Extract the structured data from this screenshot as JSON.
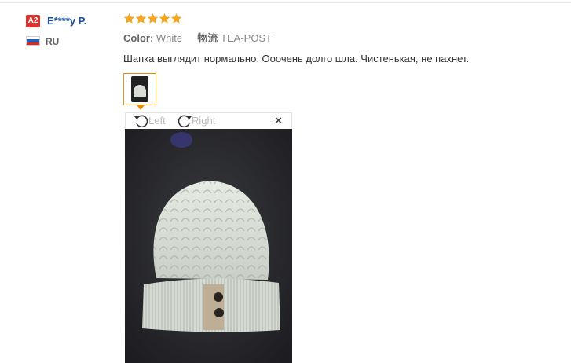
{
  "user": {
    "level": "A2",
    "name": "E****y P.",
    "country": "RU"
  },
  "review": {
    "rating": 5,
    "color_label": "Color:",
    "color_value": "White",
    "logistics_label": "物流",
    "logistics_value": "TEA-POST",
    "text": "Шапка выглядит нормально. Ооочень долго шла. Чистенькая, не пахнет."
  },
  "viewer": {
    "rotate_left_label": "Left",
    "rotate_right_label": "Right",
    "close_glyph": "×"
  },
  "colors": {
    "star": "#f5a623",
    "thumb_border": "#f08c00",
    "badge": "#e0322d",
    "username": "#1a4f9c"
  }
}
